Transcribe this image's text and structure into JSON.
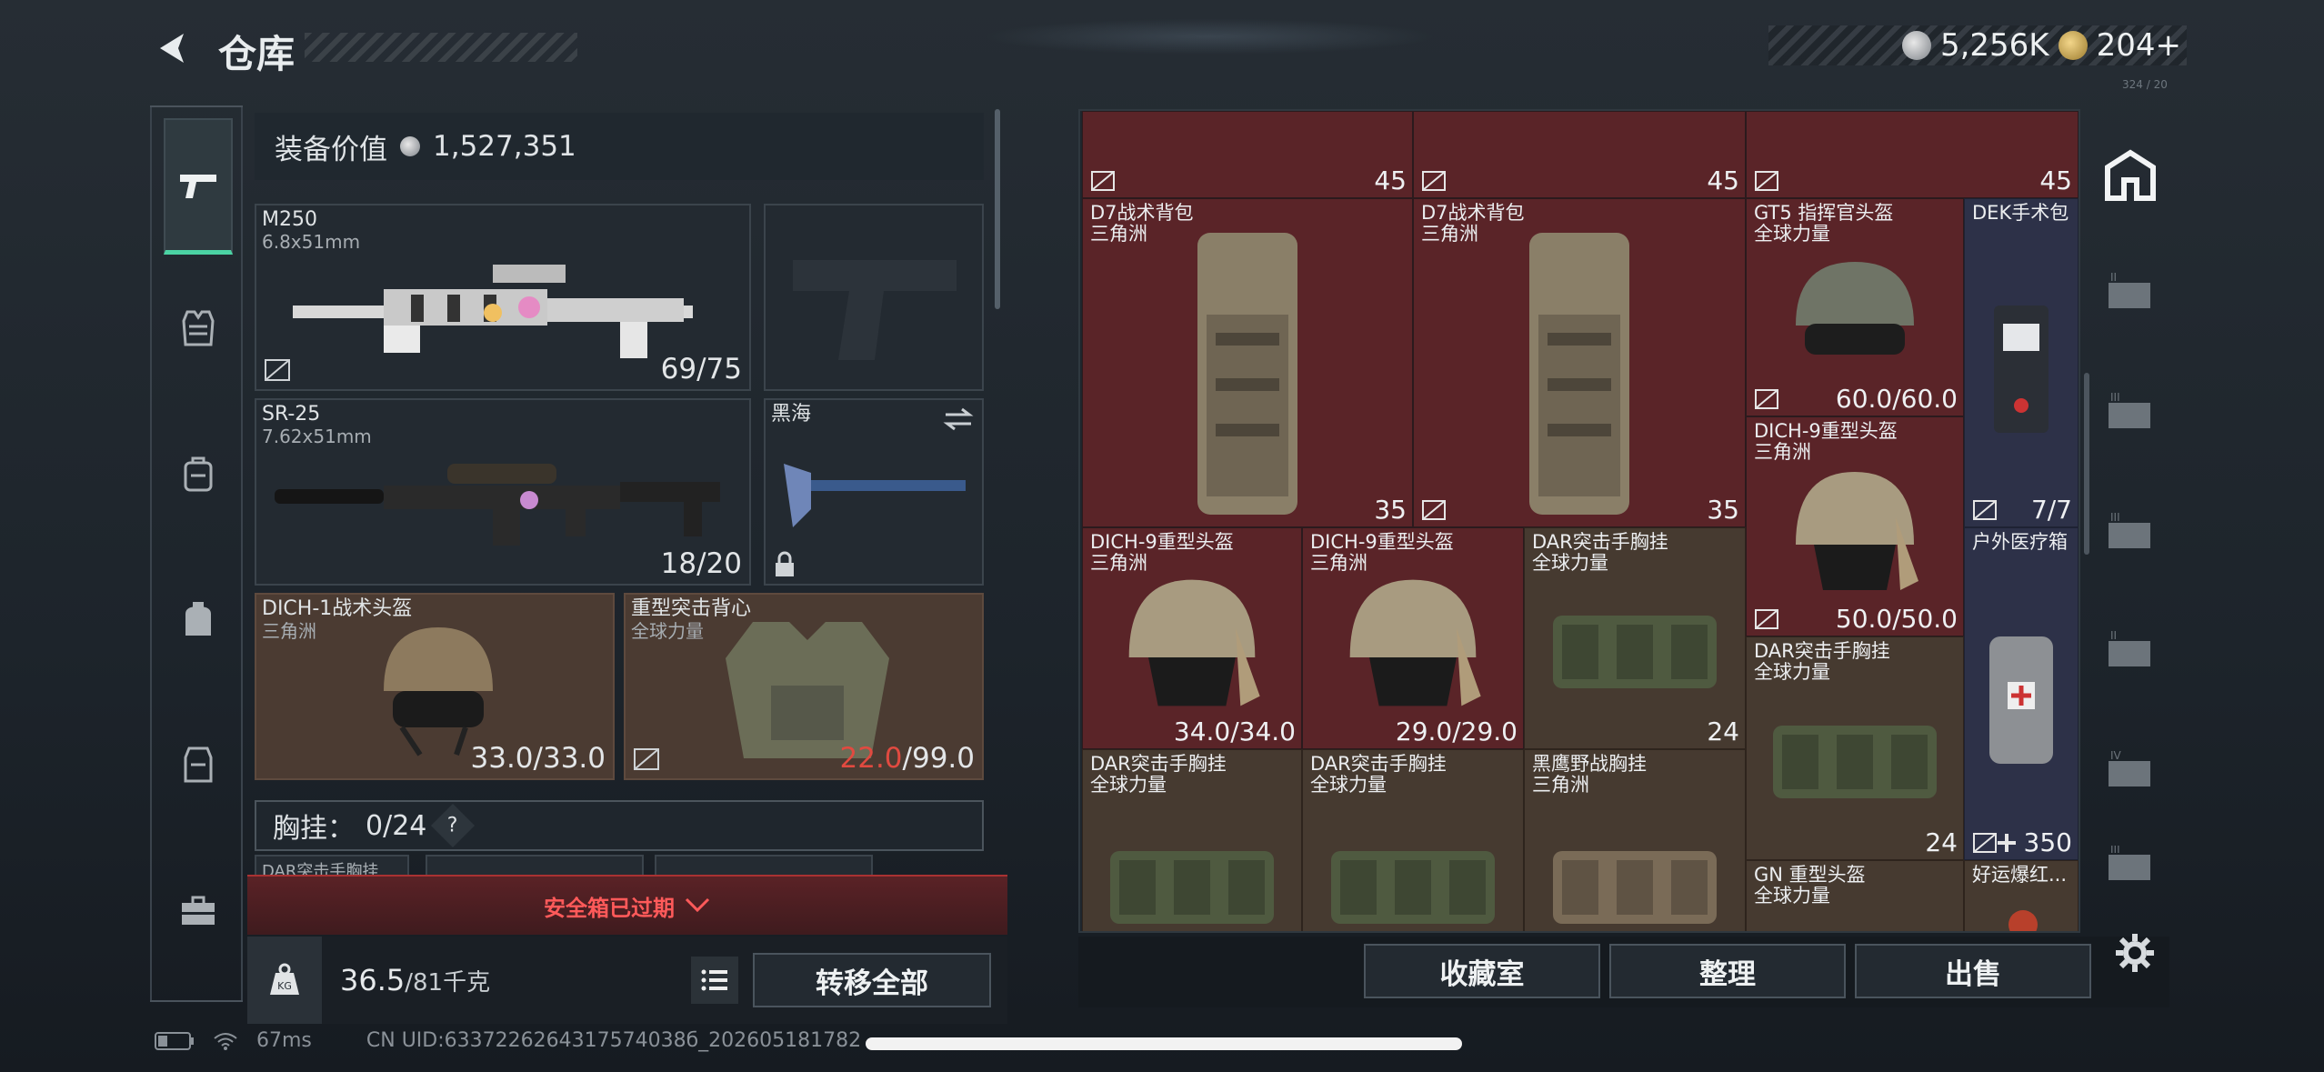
{
  "header": {
    "title": "仓库",
    "silver": "5,256K",
    "gold": "204+",
    "tiny": "324 / 20"
  },
  "left_nav": [
    "pistol-icon",
    "vest-icon",
    "backpack-icon",
    "bag-icon",
    "armor-icon",
    "toolbox-icon"
  ],
  "equip": {
    "label": "装备价值",
    "value": "1,527,351"
  },
  "slots": {
    "primary": {
      "name": "M250",
      "sub": "6.8x51mm",
      "val": "69/75"
    },
    "secondary": {
      "name": "SR-25",
      "sub": "7.62x51mm",
      "val": "18/20"
    },
    "melee": {
      "name": "黑海"
    },
    "helmet": {
      "name": "DICH-1战术头盔",
      "sub": "三角洲",
      "val": "33.0/33.0"
    },
    "armor": {
      "name": "重型突击背心",
      "sub": "全球力量",
      "val_red": "22.0",
      "val_rest": "/99.0"
    }
  },
  "chest": {
    "label": "胸挂：",
    "count": "0/24",
    "peek": "DAR突击手胸挂"
  },
  "expired": "安全箱已过期",
  "weight": {
    "value": "36.5",
    "rest": "/81千克"
  },
  "transfer_all": "转移全部",
  "grid": [
    {
      "id": "r0a",
      "name": "",
      "sub": "",
      "val": "45"
    },
    {
      "id": "r0b",
      "name": "",
      "sub": "",
      "val": "45"
    },
    {
      "id": "r0c",
      "name": "",
      "sub": "",
      "val": "45"
    },
    {
      "id": "d7a",
      "name": "D7战术背包",
      "sub": "三角洲",
      "val": "35"
    },
    {
      "id": "d7b",
      "name": "D7战术背包",
      "sub": "三角洲",
      "val": "35"
    },
    {
      "id": "gt5",
      "name": "GT5 指挥官头盔",
      "sub": "全球力量",
      "val": "60.0/60.0"
    },
    {
      "id": "dek",
      "name": "DEK手术包",
      "sub": "",
      "val": "7/7"
    },
    {
      "id": "dich9c",
      "name": "DICH-9重型头盔",
      "sub": "三角洲",
      "val": "50.0/50.0"
    },
    {
      "id": "dich9a",
      "name": "DICH-9重型头盔",
      "sub": "三角洲",
      "val": "34.0/34.0"
    },
    {
      "id": "dich9b",
      "name": "DICH-9重型头盔",
      "sub": "三角洲",
      "val": "29.0/29.0"
    },
    {
      "id": "dar1",
      "name": "DAR突击手胸挂",
      "sub": "全球力量",
      "val": "24"
    },
    {
      "id": "hw",
      "name": "户外医疗箱",
      "sub": "",
      "val": "350"
    },
    {
      "id": "dar2",
      "name": "DAR突击手胸挂",
      "sub": "全球力量",
      "val": "24"
    },
    {
      "id": "dar3",
      "name": "DAR突击手胸挂",
      "sub": "全球力量",
      "val": ""
    },
    {
      "id": "dar4",
      "name": "DAR突击手胸挂",
      "sub": "全球力量",
      "val": ""
    },
    {
      "id": "hy",
      "name": "黑鹰野战胸挂",
      "sub": "三角洲",
      "val": ""
    },
    {
      "id": "gn",
      "name": "GN 重型头盔",
      "sub": "全球力量",
      "val": ""
    },
    {
      "id": "hy2",
      "name": "好运爆红...",
      "sub": "",
      "val": ""
    }
  ],
  "right_nav": [
    "home-icon",
    "II",
    "III",
    "III",
    "II",
    "IV",
    "III"
  ],
  "bottom_buttons": {
    "collect": "收藏室",
    "sort": "整理",
    "sell": "出售"
  },
  "status": {
    "ping": "67ms",
    "uid": "CN UID:6337226264317574038б_202605181782"
  }
}
